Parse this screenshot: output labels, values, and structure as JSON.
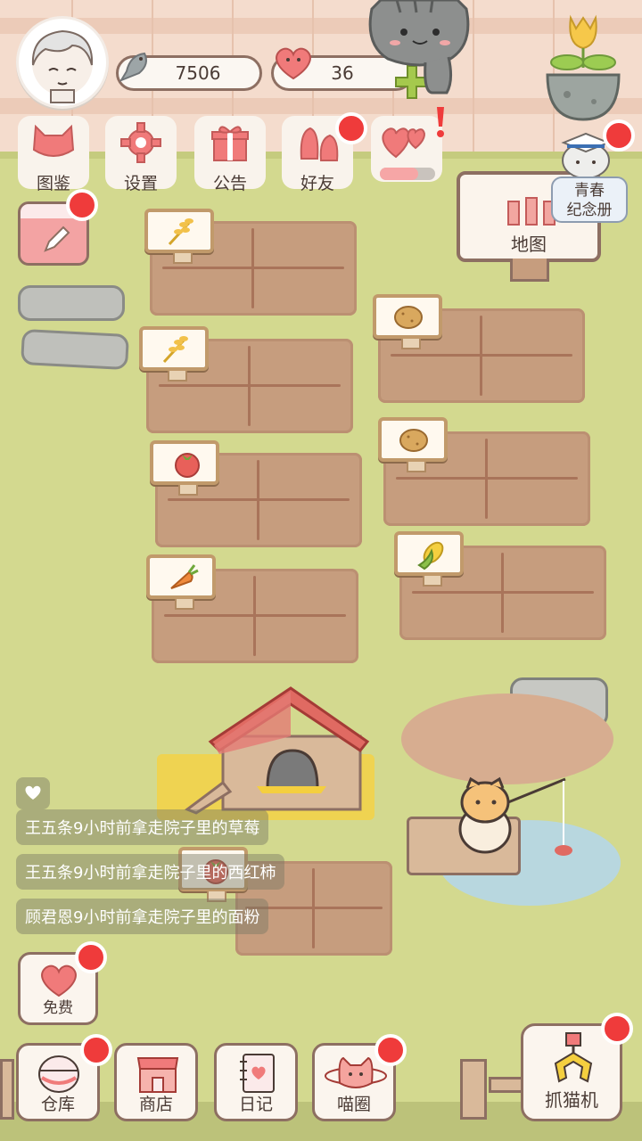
{
  "currency": {
    "fish": "7506",
    "hearts": "36"
  },
  "menu": [
    {
      "id": "catalog",
      "label": "图鉴"
    },
    {
      "id": "settings",
      "label": "设置"
    },
    {
      "id": "notice",
      "label": "公告"
    },
    {
      "id": "friends",
      "label": "好友"
    }
  ],
  "map_label": "地图",
  "memorial_label": "青春\n纪念册",
  "crops": [
    "wheat",
    "potato",
    "wheat",
    "potato",
    "tomato",
    "potato",
    "carrot",
    "corn"
  ],
  "messages": [
    "王五条9小时前拿走院子里的草莓",
    "王五条9小时前拿走院子里的西红柿",
    "顾君恩9小时前拿走院子里的面粉"
  ],
  "free_label": "免费",
  "bottom_nav": [
    {
      "id": "warehouse",
      "label": "仓库"
    },
    {
      "id": "shop",
      "label": "商店"
    },
    {
      "id": "diary",
      "label": "日记"
    },
    {
      "id": "circle",
      "label": "喵圈"
    }
  ],
  "claw_label": "抓猫机",
  "colors": {
    "badge": "#ef3b3b",
    "grass": "#d3d98f",
    "soil": "#c69d7e",
    "accent": "#f07a7a"
  }
}
